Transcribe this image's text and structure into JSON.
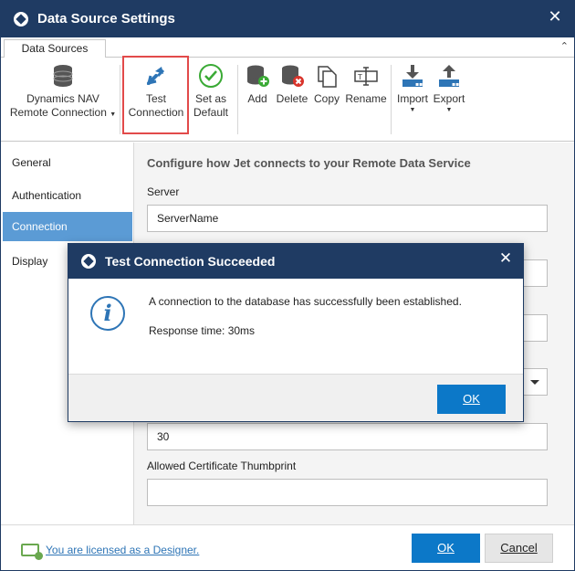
{
  "window": {
    "title": "Data Source Settings",
    "close_glyph": "✕"
  },
  "ribbon": {
    "tab_label": "Data Sources",
    "collapse_glyph": "⌃",
    "buttons": {
      "remote_connection": {
        "line1": "Dynamics NAV",
        "line2": "Remote Connection",
        "caret": "▼"
      },
      "test_connection": {
        "line1": "Test",
        "line2": "Connection"
      },
      "set_default": {
        "line1": "Set as",
        "line2": "Default"
      },
      "add": {
        "label": "Add"
      },
      "delete": {
        "label": "Delete"
      },
      "copy": {
        "label": "Copy"
      },
      "rename": {
        "label": "Rename"
      },
      "import": {
        "label": "Import",
        "caret": "▼"
      },
      "export": {
        "label": "Export",
        "caret": "▼"
      }
    }
  },
  "sidebar": {
    "items": [
      {
        "label": "General"
      },
      {
        "label": "Authentication"
      },
      {
        "label": "Connection"
      },
      {
        "label": "Display"
      }
    ],
    "active_index": 2
  },
  "content": {
    "heading": "Configure how Jet connects to your Remote Data Service",
    "server_label": "Server",
    "server_value": "ServerName",
    "timeout_value": "30",
    "thumbprint_label": "Allowed Certificate Thumbprint",
    "thumbprint_value": ""
  },
  "footer": {
    "license_text": "You are licensed as a Designer.",
    "ok_label": "OK",
    "cancel_label": "Cancel"
  },
  "dialog": {
    "title": "Test Connection Succeeded",
    "close_glyph": "✕",
    "message": "A connection to the database has successfully been established.",
    "response": "Response time: 30ms",
    "ok_label": "OK"
  },
  "colors": {
    "titlebar": "#1f3b63",
    "accent": "#0c78c8",
    "sidebar_active": "#5b9bd5",
    "highlight": "#e24a4a",
    "success_green": "#3aaa35",
    "error_red": "#d9342b"
  }
}
